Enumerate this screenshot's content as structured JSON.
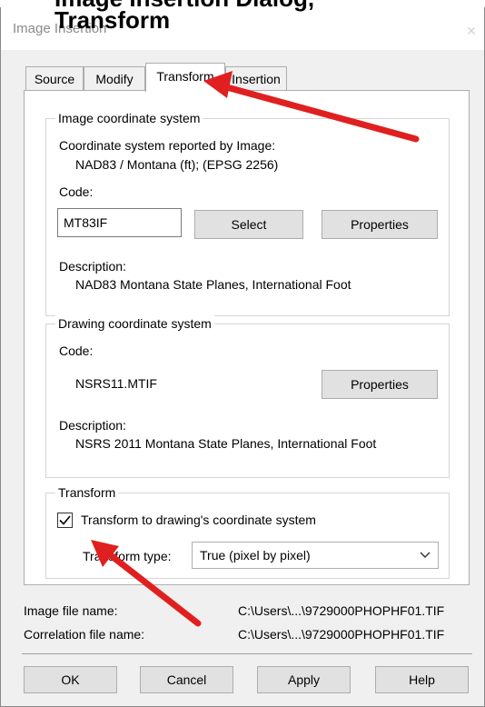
{
  "window": {
    "title": "Image Insertion",
    "close_icon": "close-icon"
  },
  "top_caption": "Image Insertion Dialog, Transform",
  "tabs": [
    {
      "label": "Source",
      "active": false
    },
    {
      "label": "Modify",
      "active": false
    },
    {
      "label": "Transform",
      "active": true
    },
    {
      "label": "Insertion",
      "active": false
    }
  ],
  "image_cs": {
    "legend": "Image coordinate system",
    "reported_label": "Coordinate system reported by Image:",
    "reported_value": "NAD83 / Montana (ft); (EPSG 2256)",
    "code_label": "Code:",
    "code_value": "MT83IF",
    "select_button": "Select",
    "properties_button": "Properties",
    "description_label": "Description:",
    "description_value": "NAD83 Montana State Planes, International Foot"
  },
  "drawing_cs": {
    "legend": "Drawing coordinate system",
    "code_label": "Code:",
    "code_value": "NSRS11.MTIF",
    "properties_button": "Properties",
    "description_label": "Description:",
    "description_value": "NSRS 2011 Montana State Planes, International Foot"
  },
  "transform": {
    "legend": "Transform",
    "checkbox_label": "Transform to drawing's coordinate system",
    "checked": true,
    "type_label": "Transform type:",
    "type_value": "True (pixel by pixel)"
  },
  "files": {
    "image_label": "Image file name:",
    "image_value": "C:\\Users\\...\\9729000PHOPHF01.TIF",
    "correlation_label": "Correlation file name:",
    "correlation_value": "C:\\Users\\...\\9729000PHOPHF01.TIF"
  },
  "footer": {
    "ok": "OK",
    "cancel": "Cancel",
    "apply": "Apply",
    "help": "Help"
  },
  "colors": {
    "arrow": "#e02020",
    "panel": "#ffffff",
    "dialog_bg": "#f0f0f0"
  }
}
